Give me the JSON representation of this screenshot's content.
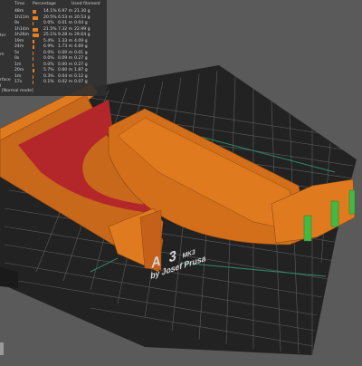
{
  "legend": {
    "headers": {
      "time": "Time",
      "percentage": "Percentage",
      "filament": "Used filament"
    },
    "rows": [
      {
        "time": "48m",
        "percentage": "14.1%",
        "length": "6.97 m",
        "weight": "21.30 g",
        "pct": 0.141
      },
      {
        "time": "1h11m",
        "percentage": "20.5%",
        "length": "6.53 m",
        "weight": "20.53 g",
        "pct": 0.205
      },
      {
        "time": "9s",
        "percentage": "0.0%",
        "length": "0.01 m",
        "weight": "0.04 g",
        "pct": 0.0
      },
      {
        "time": "1h14m",
        "percentage": "21.5%",
        "length": "7.32 m",
        "weight": "22.99 g",
        "pct": 0.215
      },
      {
        "time": "1h26m",
        "percentage": "25.1%",
        "length": "9.28 m",
        "weight": "29.64 g",
        "pct": 0.251
      },
      {
        "time": "19m",
        "percentage": "5.4%",
        "length": "1.33 m",
        "weight": "4.09 g",
        "pct": 0.054
      },
      {
        "time": "24m",
        "percentage": "6.9%",
        "length": "1.73 m",
        "weight": "4.69 g",
        "pct": 0.069
      },
      {
        "time": "5s",
        "percentage": "0.0%",
        "length": "0.00 m",
        "weight": "0.01 g",
        "pct": 0.0
      },
      {
        "time": "0s",
        "percentage": "0.0%",
        "length": "0.09 m",
        "weight": "0.27 g",
        "pct": 0.0
      },
      {
        "time": "1m",
        "percentage": "0.0%",
        "length": "0.00 m",
        "weight": "0.27 g",
        "pct": 0.0
      },
      {
        "time": "20m",
        "percentage": "5.7%",
        "length": "0.60 m",
        "weight": "1.87 g",
        "pct": 0.057
      },
      {
        "time": "1m",
        "percentage": "0.3%",
        "length": "0.04 m",
        "weight": "0.12 g",
        "pct": 0.003
      },
      {
        "time": "17s",
        "percentage": "0.1%",
        "length": "0.02 m",
        "weight": "0.07 g",
        "pct": 0.001
      }
    ],
    "side_labels": [
      "ter",
      "m",
      "rface",
      "l"
    ],
    "mode_label": "[Normal mode]"
  },
  "plate": {
    "model_letters": "A 3",
    "model_suffix": "MK3",
    "byline": "by Josef Prusa"
  },
  "colors": {
    "background": "#5a5a5a",
    "bed": "#222222",
    "grid": "#6a6a6a",
    "perimeter": "#e07a1f",
    "infill": "#b3262a",
    "support": "#43b843",
    "travel": "#2f8a68"
  },
  "icons": {
    "corner_marker": "grey-marker-icon"
  }
}
